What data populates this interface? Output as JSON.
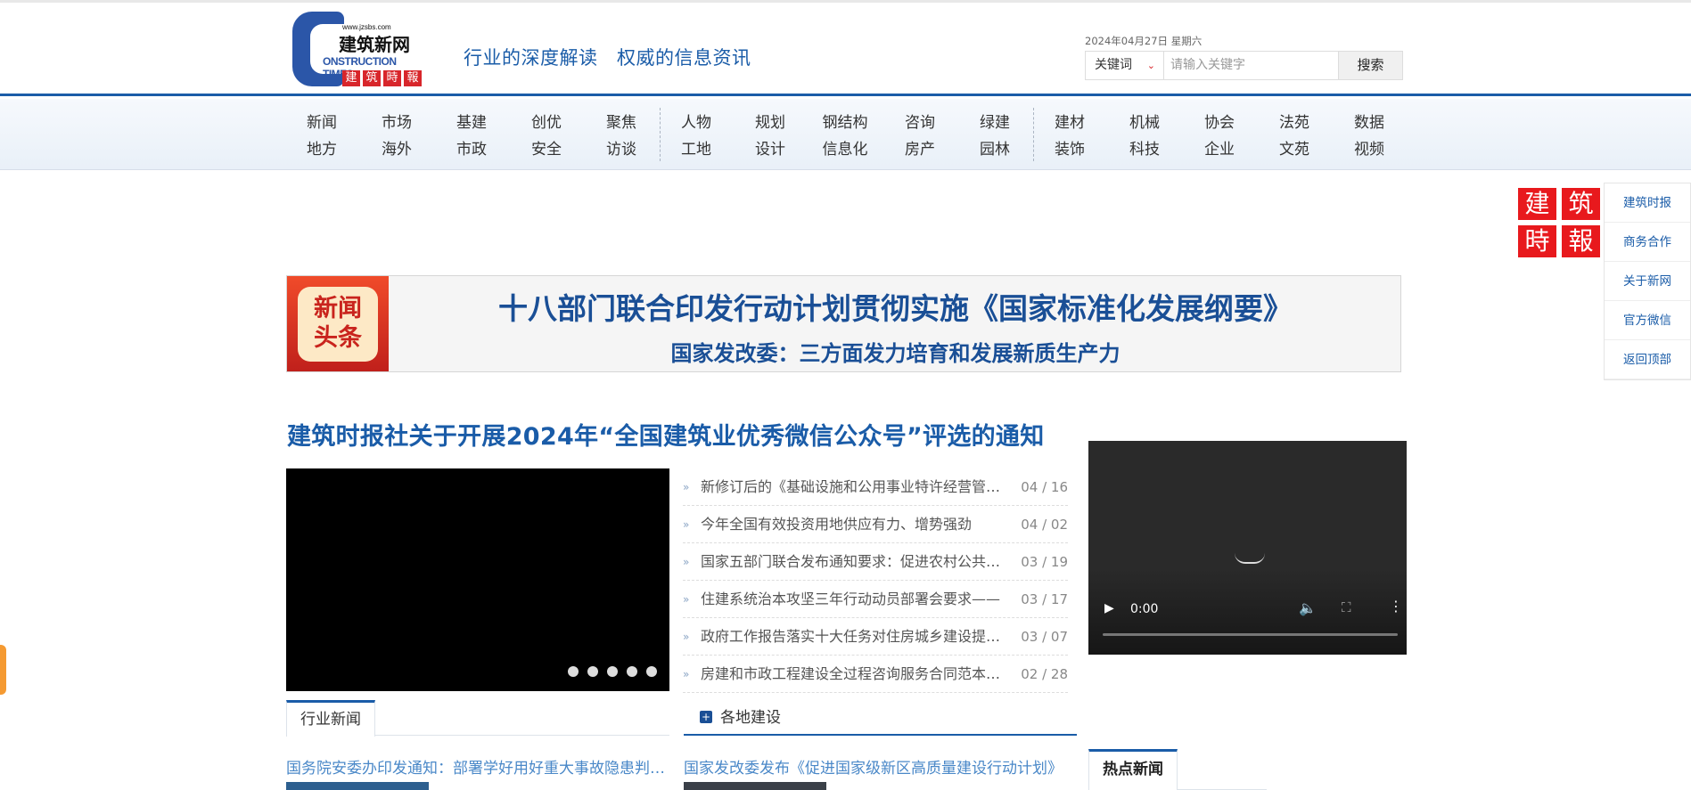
{
  "header": {
    "logo": {
      "url": "www.jzsbs.com",
      "cn": "建筑新网",
      "en": "ONSTRUCTION TIMES",
      "seal": [
        "建",
        "筑",
        "時",
        "報"
      ]
    },
    "slogan": "行业的深度解读　权威的信息资讯",
    "date": "2024年04月27日 星期六",
    "search": {
      "select_value": "关键词",
      "placeholder": "请输入关键字",
      "button_label": "搜索"
    }
  },
  "nav": {
    "columns": [
      [
        "新闻",
        "地方"
      ],
      [
        "市场",
        "海外"
      ],
      [
        "基建",
        "市政"
      ],
      [
        "创优",
        "安全"
      ],
      [
        "聚焦",
        "访谈"
      ],
      [
        "人物",
        "工地"
      ],
      [
        "规划",
        "设计"
      ],
      [
        "钢结构",
        "信息化"
      ],
      [
        "咨询",
        "房产"
      ],
      [
        "绿建",
        "园林"
      ],
      [
        "建材",
        "装饰"
      ],
      [
        "机械",
        "科技"
      ],
      [
        "协会",
        "企业"
      ],
      [
        "法苑",
        "文苑"
      ],
      [
        "数据",
        "视频"
      ]
    ]
  },
  "float": {
    "logo": [
      "建",
      "筑",
      "時",
      "報"
    ],
    "menu": [
      "建筑时报",
      "商务合作",
      "关于新网",
      "官方微信",
      "返回顶部"
    ]
  },
  "headline": {
    "badge": [
      "新闻",
      "头条"
    ],
    "main": "十八部门联合印发行动计划贯彻实施《国家标准化发展纲要》",
    "sub": "国家发改委：三方面发力培育和发展新质生产力"
  },
  "notice": "建筑时报社关于开展2024年“全国建筑业优秀微信公众号”评选的通知",
  "news": [
    {
      "title": "新修订后的《基础设施和公用事业特许经营管理办法》",
      "date": "04 / 16"
    },
    {
      "title": "今年全国有效投资用地供应有力、增势强劲",
      "date": "04 / 02"
    },
    {
      "title": "国家五部门联合发布通知要求：促进农村公共基础设施",
      "date": "03 / 19"
    },
    {
      "title": "住建系统治本攻坚三年行动动员部署会要求——",
      "date": "03 / 17"
    },
    {
      "title": "政府工作报告落实十大任务对住房城乡建设提出要求",
      "date": "03 / 07"
    },
    {
      "title": "房建和市政工程建设全过程咨询服务合同范本发布",
      "date": "02 / 28"
    }
  ],
  "video": {
    "time": "0:00"
  },
  "tabs": {
    "industry": "行业新闻",
    "local": "各地建设",
    "hot": "热点新闻"
  },
  "links": {
    "industry": "国务院安委办印发通知：部署学好用好重大事故隐患判定标准",
    "local": "国家发改委发布《促进国家级新区高质量建设行动计划》"
  }
}
